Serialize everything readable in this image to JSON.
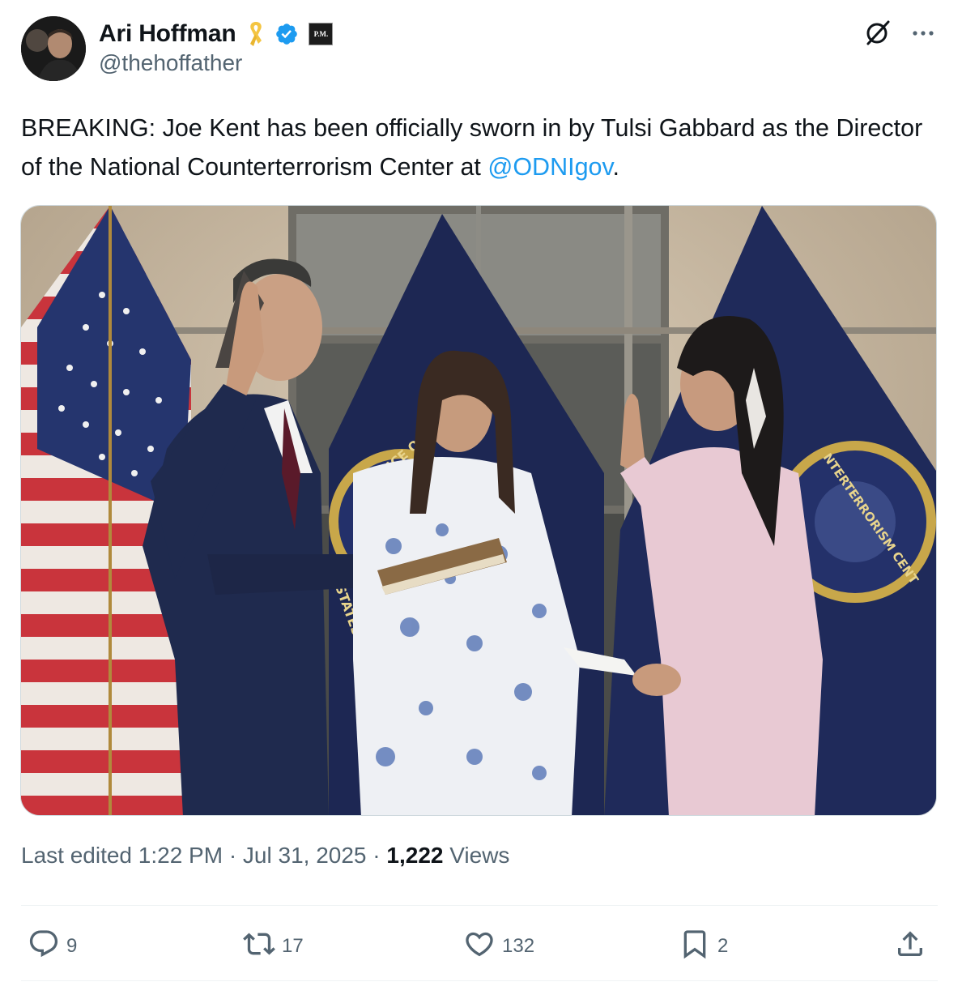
{
  "author": {
    "display_name": "Ari Hoffman",
    "handle": "@thehoffather",
    "affiliate_badge": "P.M.",
    "icons": [
      "yellow-ribbon-icon",
      "verified-badge-icon"
    ]
  },
  "tweet": {
    "text_before_mention": "BREAKING: Joe Kent has been officially sworn in by Tulsi Gabbard as the Director of the National Counterterrorism Center at ",
    "mention": "@ODNIgov",
    "text_after_mention": "."
  },
  "photo": {
    "seal_left": "OFFICE OF THE",
    "seal_left_bottom": "STATES OF AM",
    "seal_right": "NTERTERRORISM CENT"
  },
  "meta": {
    "edited_prefix": "Last edited 1:22 PM · Jul 31, 2025 · ",
    "views_count": "1,222",
    "views_label": " Views"
  },
  "actions": {
    "replies": "9",
    "reposts": "17",
    "likes": "132",
    "bookmarks": "2"
  },
  "colors": {
    "link": "#1d9bf0",
    "secondary_text": "#536471",
    "primary_text": "#0f1419",
    "verified": "#1d9bf0",
    "ribbon": "#f4c542"
  }
}
